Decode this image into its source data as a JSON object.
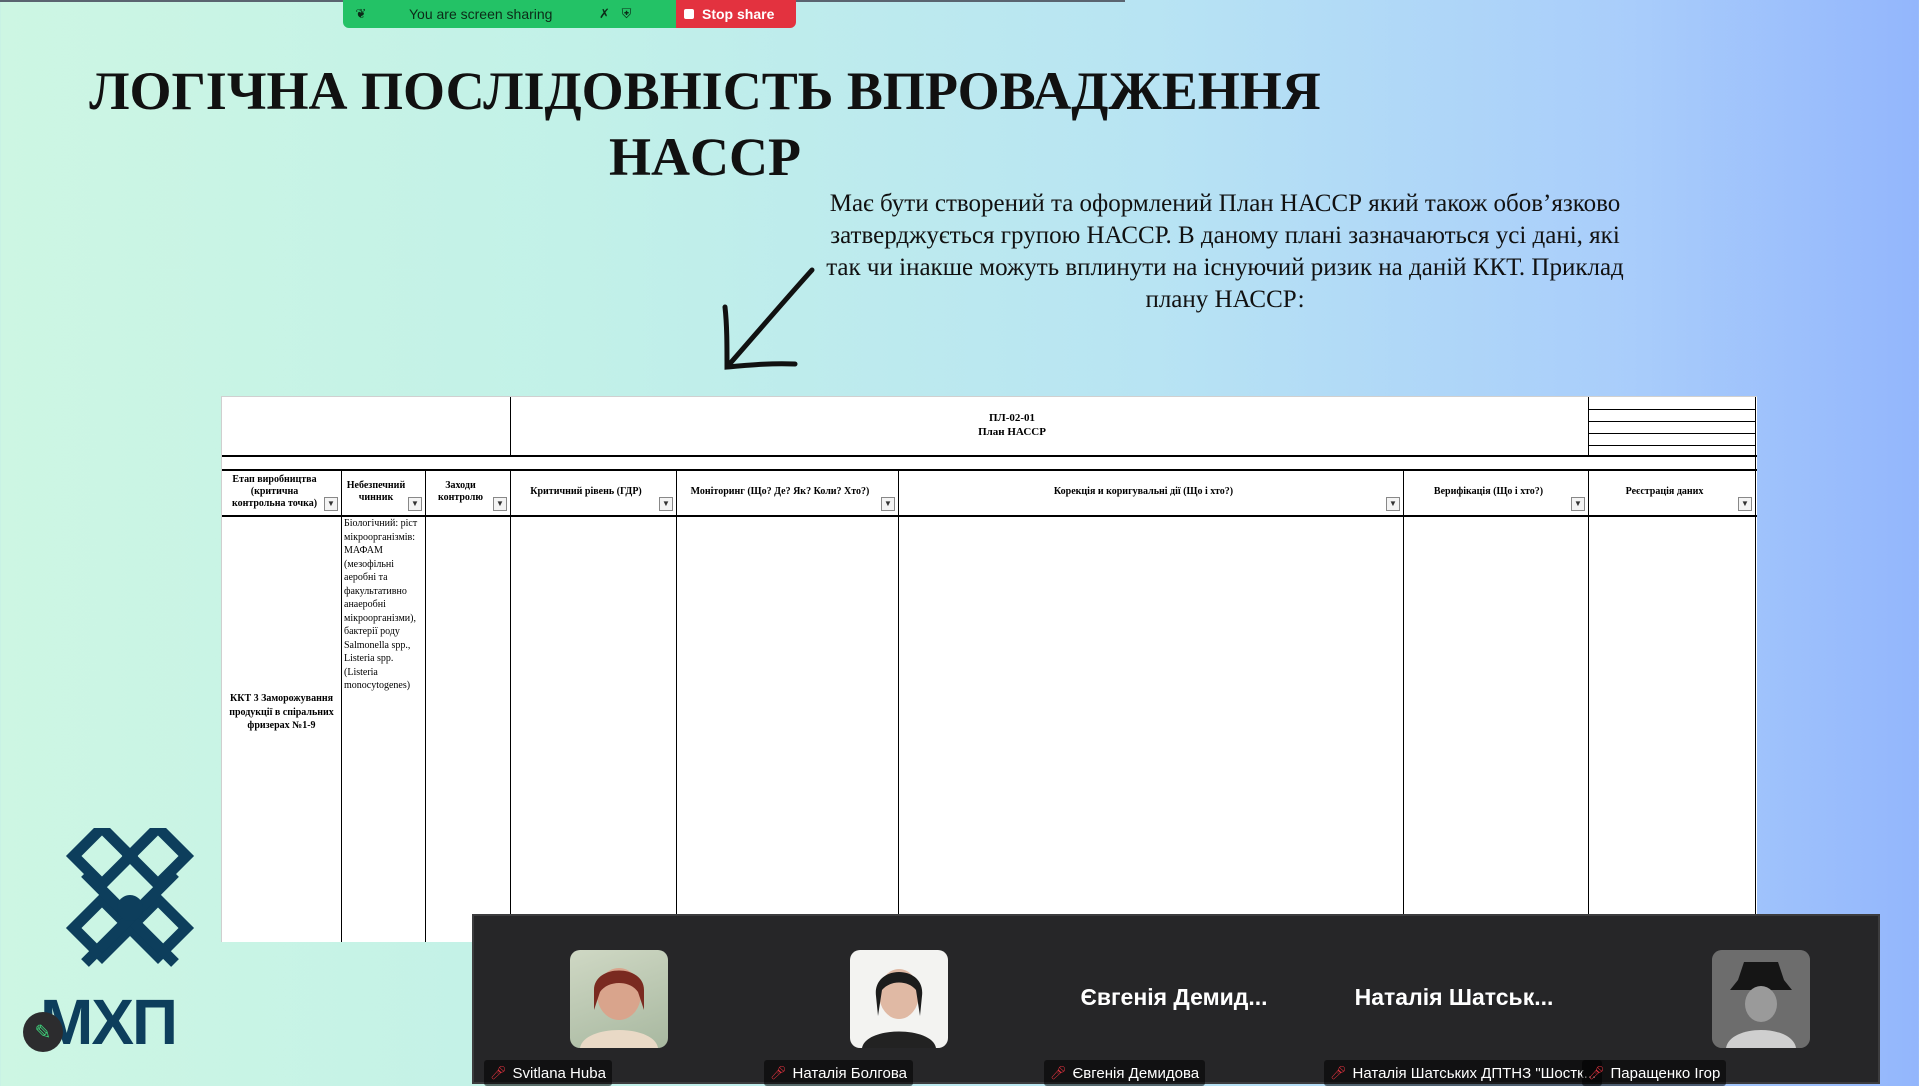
{
  "share_bar": {
    "status": "You are screen sharing",
    "stop_label": "Stop share"
  },
  "slide": {
    "title_line1": "ЛОГІЧНА ПОСЛІДОВНІСТЬ ВПРОВАДЖЕННЯ",
    "title_line2": "HACCP",
    "description": "Має бути створений та оформлений План НАССР який також обов’язково затверджується групою НАССР. В даному плані зазначаються усі дані, які так чи інакше можуть вплинути на існуючий ризик на даній ККТ. Приклад плану НАССР:"
  },
  "plan": {
    "code": "ПЛ-02-01",
    "name": "План НАССР",
    "columns": [
      "Етап виробництва (критична контрольна точка)",
      "Небезпечний чинник",
      "Заходи контролю",
      "Критичний рівень (ГДР)",
      "Моніторинг (Що? Де? Як? Коли? Хто?)",
      "Корекція и коригувальні дії (Що і хто?)",
      "Верифікація (Що і хто?)",
      "Реєстрація даних"
    ],
    "row_stage": "ККТ 3 Заморожування продукції в спіральних фризерах №1-9",
    "row_hazard": "Біологічний: ріст мікроорганізмів: МАФАМ (мезофільні аеробні та факультативно анаеробні мікроорганізми), бактерії роду Salmonella spp., Listeria spp. (Listeria monocytogenes)"
  },
  "participants": [
    {
      "name": "Svitlana Huba",
      "display": "",
      "avatar": "photo-woman-1"
    },
    {
      "name": "Наталія Болгова",
      "display": "",
      "avatar": "photo-woman-2"
    },
    {
      "name": "Євгенія Демидова",
      "display": "Євгенія Демид...",
      "avatar": ""
    },
    {
      "name": "Наталія Шатських ДПТНЗ \"Шостк...",
      "display": "Наталія Шатськ...",
      "avatar": ""
    },
    {
      "name": "Паращенко Ігор",
      "display": "",
      "avatar": "photo-man-hat"
    }
  ],
  "logo": {
    "text": "МХП"
  },
  "colors": {
    "share_green": "#23c266",
    "stop_red": "#e3323f",
    "logo_blue": "#0d3e5c"
  }
}
